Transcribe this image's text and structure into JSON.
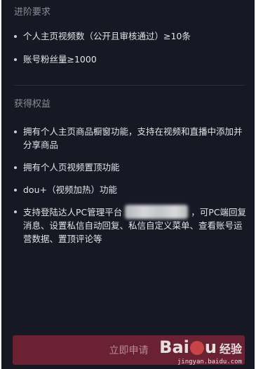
{
  "requirements": {
    "title": "进阶要求",
    "items": [
      "个人主页视频数（公开且审核通过）≥10条",
      "账号粉丝量≥1000"
    ]
  },
  "benefits": {
    "title": "获得权益",
    "items": [
      "拥有个人主页商品橱窗功能，支持在视频和直播中添加并分享商品",
      "拥有个人页视频置顶功能",
      "dou+（视频加热）功能"
    ],
    "item4_part1": "支持登陆达人PC管理平台",
    "item4_part2": "，可PC端回复消息、设置私信自动回复、私信自定义菜单、查看账号运营数据、置顶评论等"
  },
  "apply_button": {
    "label": "立即申请"
  },
  "watermark": {
    "logo_left": "Bai",
    "logo_right": "u",
    "sub": "经验",
    "url": "jingyan.baidu.com"
  },
  "colors": {
    "background": "#161823",
    "button": "#6a2232",
    "text": "#e2e3e6",
    "muted": "#8c8d93"
  }
}
